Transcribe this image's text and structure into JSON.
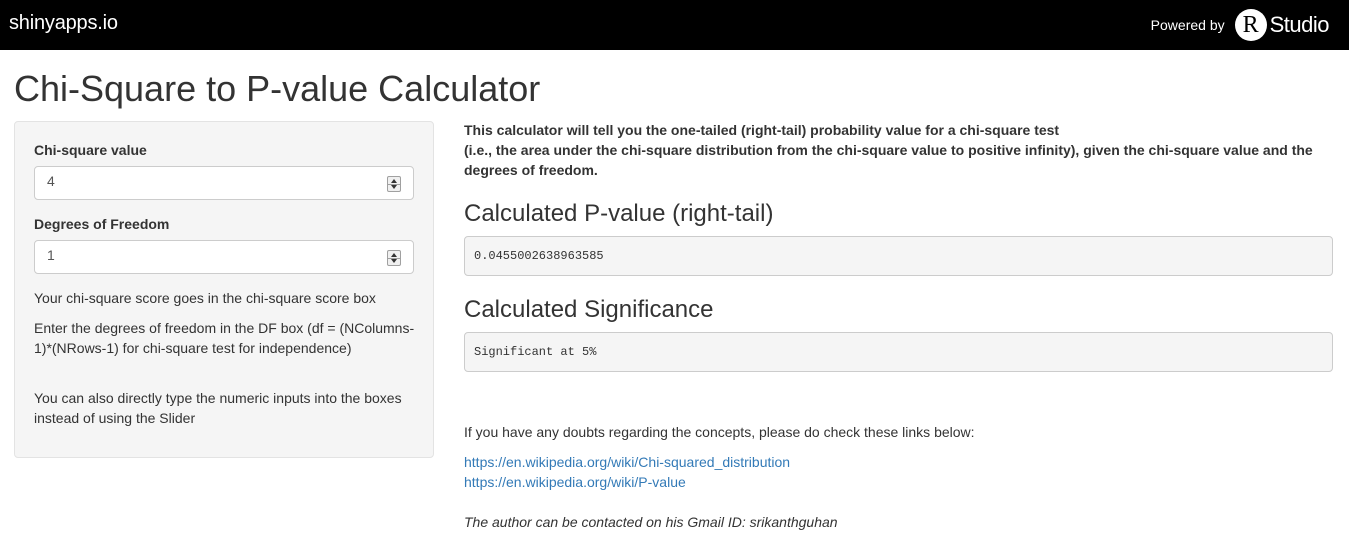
{
  "navbar": {
    "brand": "shinyapps.io",
    "powered_by": "Powered by",
    "r_letter": "R",
    "studio": "Studio"
  },
  "title": "Chi-Square to P-value Calculator",
  "sidebar": {
    "chi_label": "Chi-square value",
    "chi_value": "4",
    "df_label": "Degrees of Freedom",
    "df_value": "1",
    "help1": "Your chi-square score goes in the chi-square score box",
    "help2": "Enter the degrees of freedom in the DF box (df = (NColumns-1)*(NRows-1) for chi-square test for independence)",
    "help3": "You can also directly type the numeric inputs into the boxes instead of using the Slider"
  },
  "main": {
    "intro_line1": "This calculator will tell you the one-tailed (right-tail) probability value for a chi-square test",
    "intro_line2": "(i.e., the area under the chi-square distribution from the chi-square value to positive infinity), given the chi-square value and the degrees of freedom.",
    "pvalue_heading": "Calculated P-value (right-tail)",
    "pvalue": "0.0455002638963585",
    "significance_heading": "Calculated Significance",
    "significance": "Significant at 5%",
    "doubts": "If you have any doubts regarding the concepts, please do check these links below:",
    "link1": "https://en.wikipedia.org/wiki/Chi-squared_distribution",
    "link2": "https://en.wikipedia.org/wiki/P-value",
    "author": "The author can be contacted on his Gmail ID: srikanthguhan"
  }
}
